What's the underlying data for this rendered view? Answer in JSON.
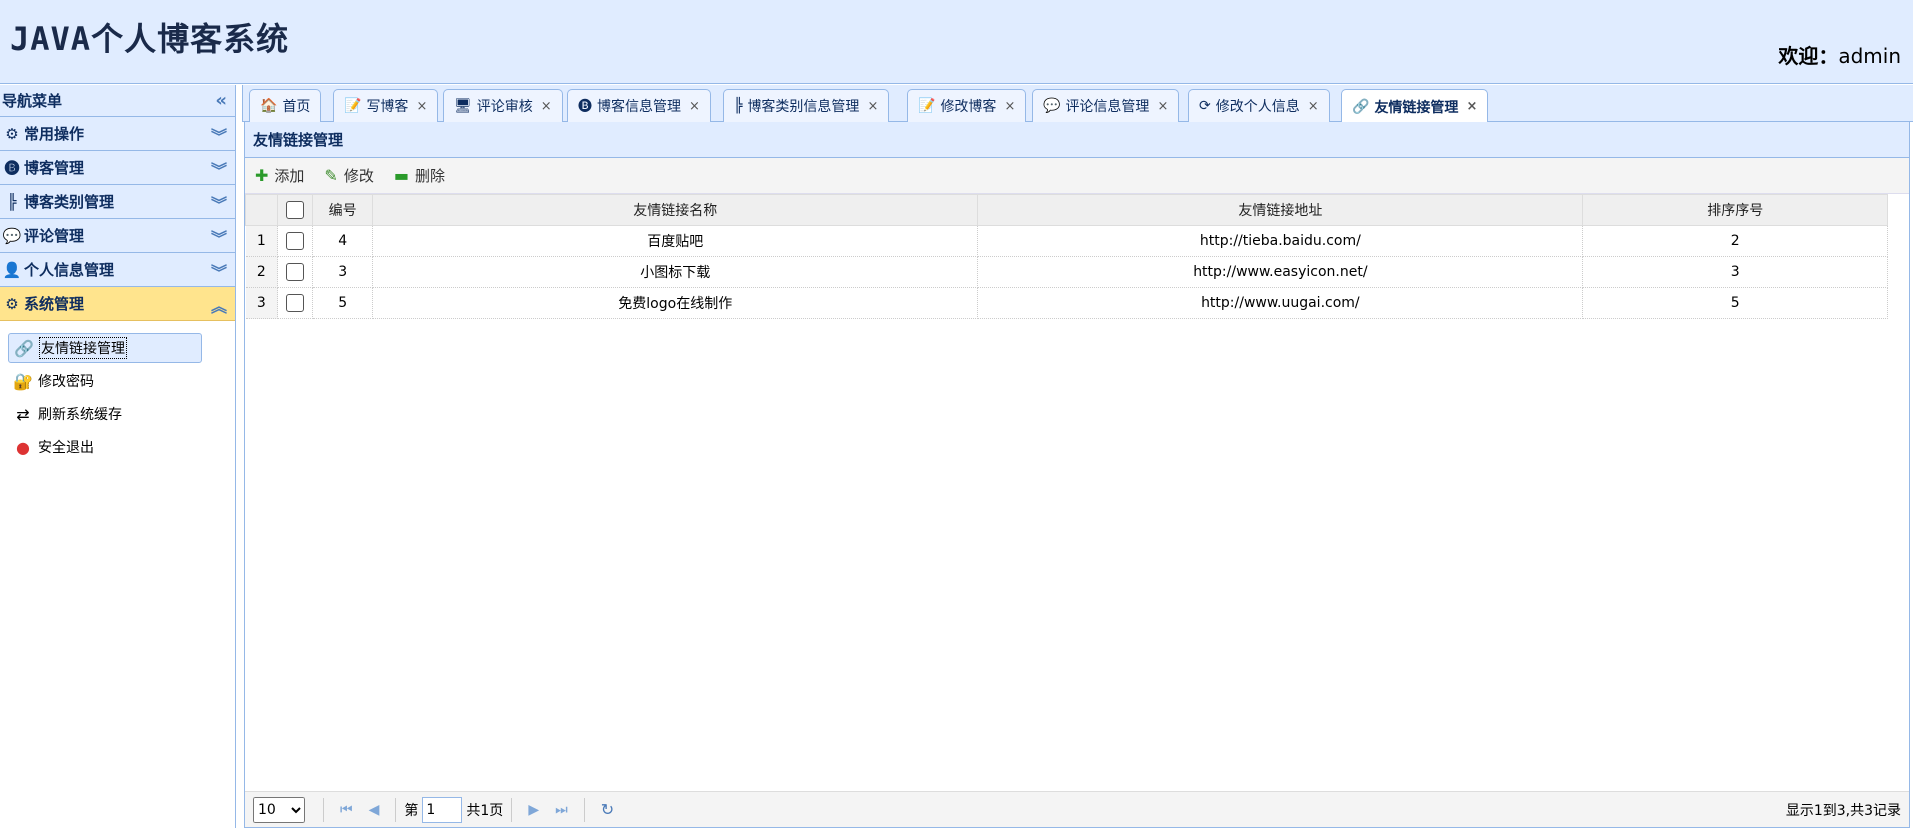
{
  "header": {
    "logo": "JAVA个人博客系统",
    "welcome_label": "欢迎：",
    "user": "admin"
  },
  "sidebar": {
    "title": "导航菜单",
    "sections": [
      {
        "label": "常用操作",
        "icon": "gear-icon"
      },
      {
        "label": "博客管理",
        "icon": "blog-icon"
      },
      {
        "label": "博客类别管理",
        "icon": "tree-icon"
      },
      {
        "label": "评论管理",
        "icon": "comment-icon"
      },
      {
        "label": "个人信息管理",
        "icon": "user-icon"
      },
      {
        "label": "系统管理",
        "icon": "system-icon"
      }
    ],
    "sub_items": [
      {
        "label": "友情链接管理",
        "icon": "link-icon"
      },
      {
        "label": "修改密码",
        "icon": "password-icon"
      },
      {
        "label": "刷新系统缓存",
        "icon": "refresh-icon"
      },
      {
        "label": "安全退出",
        "icon": "exit-icon"
      }
    ]
  },
  "tabs": [
    {
      "label": "首页",
      "icon": "home-icon"
    },
    {
      "label": "写博客",
      "icon": "edit-icon"
    },
    {
      "label": "评论审核",
      "icon": "review-icon"
    },
    {
      "label": "博客信息管理",
      "icon": "blog-icon"
    },
    {
      "label": "博客类别信息管理",
      "icon": "tree-icon"
    },
    {
      "label": "修改博客",
      "icon": "edit-icon"
    },
    {
      "label": "评论信息管理",
      "icon": "comment-icon"
    },
    {
      "label": "修改个人信息",
      "icon": "refresh-icon"
    },
    {
      "label": "友情链接管理",
      "icon": "link-icon"
    }
  ],
  "panel": {
    "title": "友情链接管理",
    "toolbar": {
      "add": "添加",
      "edit": "修改",
      "delete": "删除"
    },
    "columns": [
      "编号",
      "友情链接名称",
      "友情链接地址",
      "排序序号"
    ],
    "rows": [
      {
        "rn": "1",
        "id": "4",
        "name": "百度贴吧",
        "url": "http://tieba.baidu.com/",
        "order": "2"
      },
      {
        "rn": "2",
        "id": "3",
        "name": "小图标下载",
        "url": "http://www.easyicon.net/",
        "order": "3"
      },
      {
        "rn": "3",
        "id": "5",
        "name": "免费logo在线制作",
        "url": "http://www.uugai.com/",
        "order": "5"
      }
    ]
  },
  "pager": {
    "page_size": "10",
    "page_label": "第",
    "page_value": "1",
    "total_pages_label": "共1页",
    "info": "显示1到3,共3记录"
  },
  "colors": {
    "header_bg": "#e0ecff",
    "border": "#95b8e7",
    "active_section": "#ffe48d"
  }
}
